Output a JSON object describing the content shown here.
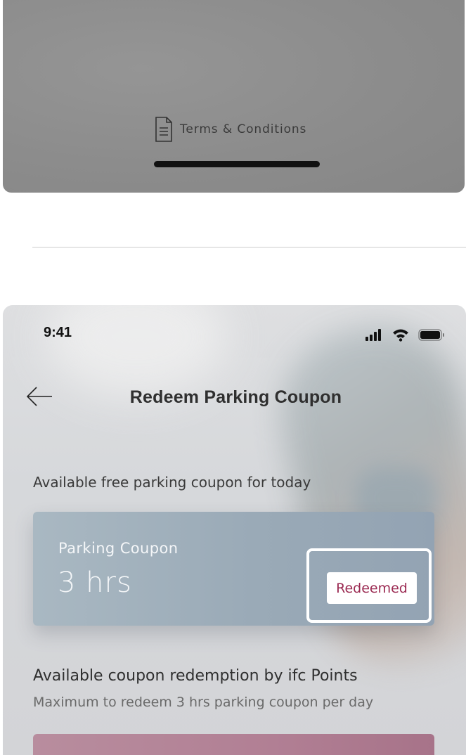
{
  "top_card": {
    "terms_label": "Terms & Conditions"
  },
  "status_bar": {
    "time": "9:41"
  },
  "nav": {
    "title": "Redeem Parking Coupon"
  },
  "free_coupon_section": {
    "heading": "Available free parking coupon for today",
    "coupon": {
      "label": "Parking Coupon",
      "value": "3 hrs",
      "status": "Redeemed"
    }
  },
  "points_section": {
    "heading": "Available coupon redemption by ifc Points",
    "subheading": "Maximum to redeem 3 hrs parking coupon per day"
  },
  "colors": {
    "redeemed_text": "#9b2a52",
    "coupon_card": "#9aaab7",
    "points_card": "#b17f94"
  },
  "icons": [
    "document-icon",
    "signal-icon",
    "wifi-icon",
    "battery-icon",
    "back-arrow-icon"
  ]
}
